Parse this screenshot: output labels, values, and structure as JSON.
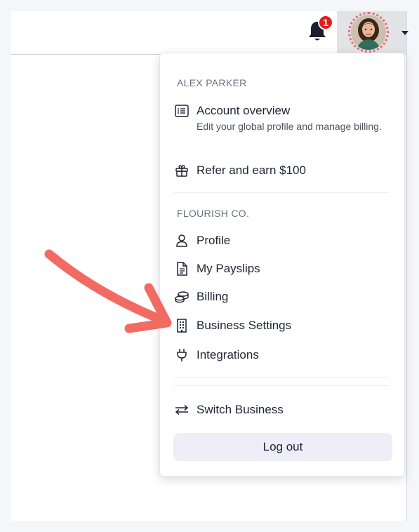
{
  "header": {
    "notifications": {
      "icon": "bell-icon",
      "count": "1"
    },
    "avatar": {
      "icon": "user-avatar",
      "caret_icon": "caret-down-icon"
    }
  },
  "menu": {
    "account_section": {
      "label": "ALEX PARKER",
      "items": [
        {
          "icon": "list-icon",
          "label": "Account overview",
          "description": "Edit your global profile and manage billing."
        },
        {
          "icon": "gift-icon",
          "label": "Refer and earn $100"
        }
      ]
    },
    "business_section": {
      "label": "FLOURISH CO.",
      "items": [
        {
          "icon": "user-icon",
          "label": "Profile"
        },
        {
          "icon": "document-icon",
          "label": "My Payslips"
        },
        {
          "icon": "coins-icon",
          "label": "Billing"
        },
        {
          "icon": "building-icon",
          "label": "Business Settings"
        },
        {
          "icon": "plug-icon",
          "label": "Integrations"
        }
      ]
    },
    "switch_business": {
      "icon": "switch-arrows-icon",
      "label": "Switch Business"
    },
    "logout_label": "Log out"
  },
  "colors": {
    "accent_arrow": "#f26b63",
    "badge": "#e21d1d",
    "logout_bg": "#eeedf8",
    "text": "#1f2433"
  }
}
